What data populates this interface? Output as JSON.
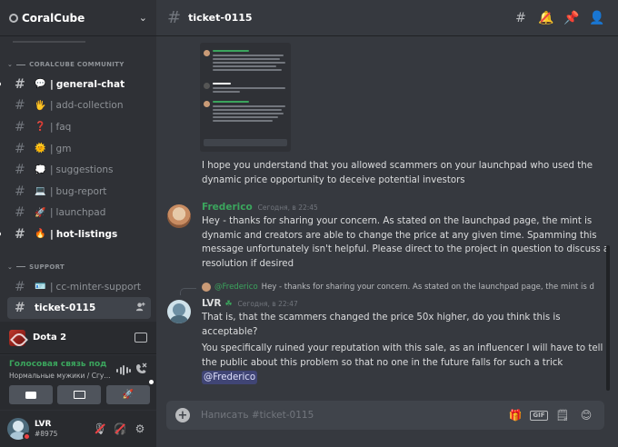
{
  "server": {
    "name": "CoralCube"
  },
  "categories": [
    {
      "name": "CORALCUBE COMMUNITY"
    },
    {
      "name": "SUPPORT"
    }
  ],
  "channels": [
    {
      "emoji": "💬",
      "name": "general-chat"
    },
    {
      "emoji": "🖐",
      "name": "add-collection"
    },
    {
      "emoji": "❓",
      "name": "faq"
    },
    {
      "emoji": "🌞",
      "name": "gm"
    },
    {
      "emoji": "💭",
      "name": "suggestions"
    },
    {
      "emoji": "💻",
      "name": "bug-report"
    },
    {
      "emoji": "🚀",
      "name": "launchpad"
    },
    {
      "emoji": "🔥",
      "name": "hot-listings"
    },
    {
      "emoji": "🪪",
      "name": "cc-minter-support"
    },
    {
      "name": "ticket-0115"
    }
  ],
  "channel_separator": "|",
  "activity": {
    "game": "Dota 2"
  },
  "voice": {
    "status": "Голосовая связь под",
    "channel": "Нормальные мужики / Сгу..."
  },
  "user": {
    "name": "LVR",
    "tag": "#8975"
  },
  "header": {
    "channel": "ticket-0115"
  },
  "messages": {
    "continued_text": "I hope you understand that you allowed scammers on your launchpad who used the dynamic price opportunity to deceive potential investors",
    "frederico": {
      "author": "Frederico",
      "timestamp": "Сегодня, в 22:45",
      "text": "Hey - thanks for sharing your concern. As stated on the launchpad page, the mint is dynamic and creators are able to change the price at any given time. Spamming this message unfortunately isn't helpful. Please direct to the project in question to discuss a resolution if desired"
    },
    "lvr": {
      "reply_mention": "@Frederico",
      "reply_text": "Hey - thanks for sharing your concern. As stated on the launchpad page, the mint is d",
      "author": "LVR",
      "timestamp": "Сегодня, в 22:47",
      "text_1": "That is, that the scammers changed the price 50x higher, do you think this is acceptable?",
      "text_2": "You specifically ruined your reputation with this sale, as an influencer I will have to tell the public about this problem so that no one in the future falls for such a trick",
      "mention": "@Frederico"
    }
  },
  "composer": {
    "placeholder": "Написать #ticket-0115"
  },
  "icons": {
    "threads": "threads-icon",
    "mute": "notification-off-icon",
    "pin": "pin-icon",
    "members": "members-icon",
    "gift": "gift-icon",
    "gif": "GIF",
    "sticker": "sticker-icon",
    "emoji": "emoji-icon"
  },
  "colors": {
    "background": "#36393f",
    "sidebar": "#2f3136",
    "panel": "#292b2f",
    "green": "#3ba55d",
    "red": "#ed4245",
    "blurple": "#5865f2"
  }
}
